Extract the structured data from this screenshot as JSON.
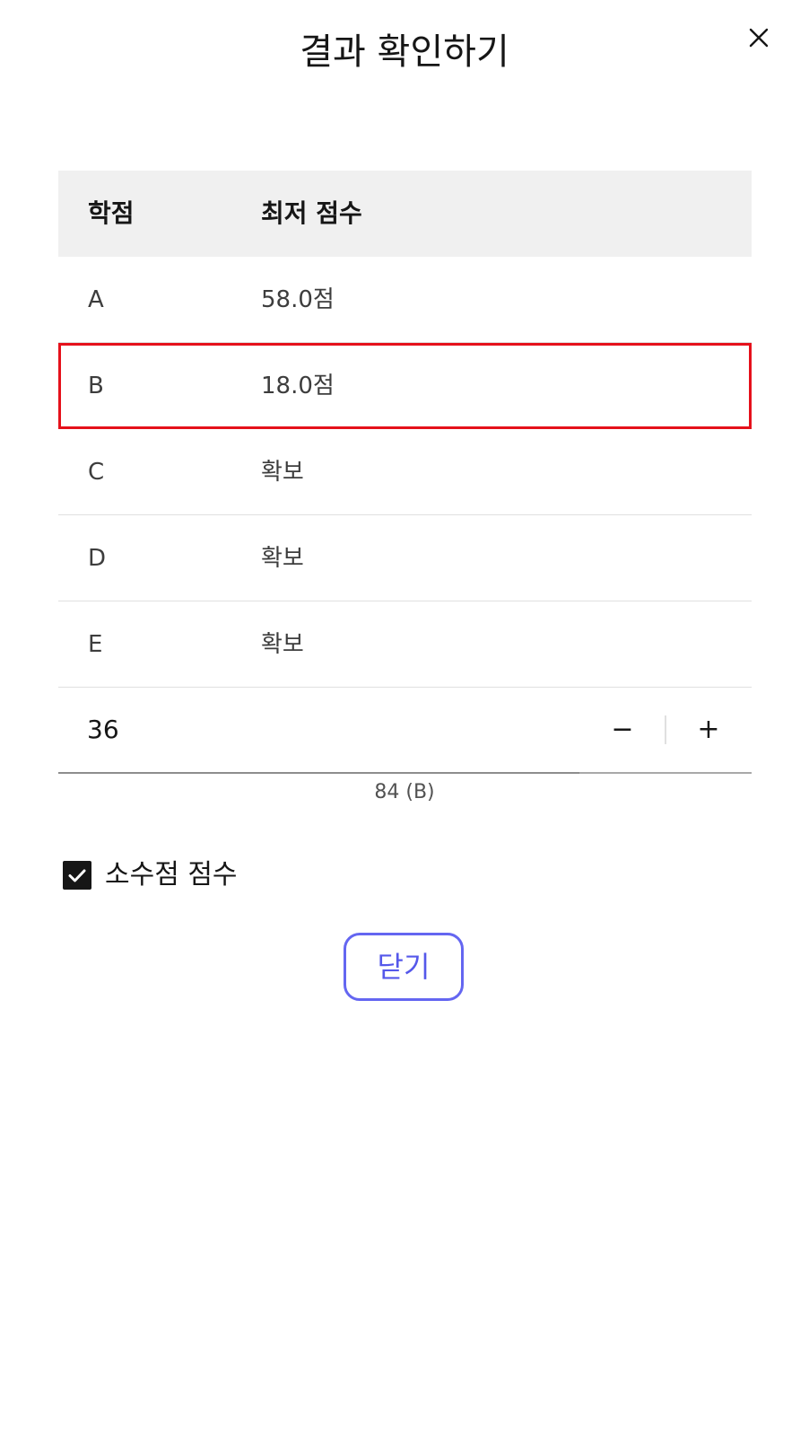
{
  "modal": {
    "title": "결과 확인하기"
  },
  "table": {
    "headers": {
      "grade": "학점",
      "min_score": "최저 점수"
    },
    "rows": [
      {
        "grade": "A",
        "min_score": "58.0점"
      },
      {
        "grade": "B",
        "min_score": "18.0점"
      },
      {
        "grade": "C",
        "min_score": "확보"
      },
      {
        "grade": "D",
        "min_score": "확보"
      },
      {
        "grade": "E",
        "min_score": "확보"
      }
    ],
    "highlighted_row_index": 1,
    "highlight_color": "#e5111b"
  },
  "stepper": {
    "value": "36",
    "decrement_label": "−",
    "increment_label": "+",
    "helper_text": "84 (B)"
  },
  "options": {
    "decimal_score_label": "소수점 점수",
    "decimal_score_checked": true
  },
  "actions": {
    "close_label": "닫기",
    "accent_color": "#6466f1"
  },
  "icons": {
    "close": "close-icon",
    "checkbox": "checkmark-icon"
  }
}
